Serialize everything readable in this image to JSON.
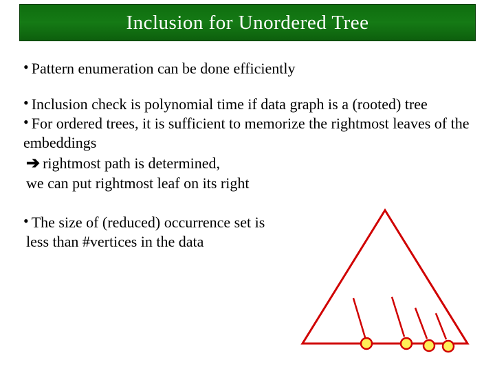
{
  "title": "Inclusion for Unordered Tree",
  "p1": "Pattern enumeration can be done efficiently",
  "p2a": "Inclusion check is polynomial time if data graph is a (rooted) tree",
  "p2b": "For ordered trees, it is sufficient to memorize the rightmost leaves of the embeddings",
  "p2c": "rightmost path is determined,",
  "p2d": "we can put rightmost leaf on its right",
  "p3a": "The size of (reduced) occurrence set is",
  "p3b": "less than #vertices in the data",
  "bullet_glyph": "•",
  "arrow_glyph": "➔"
}
